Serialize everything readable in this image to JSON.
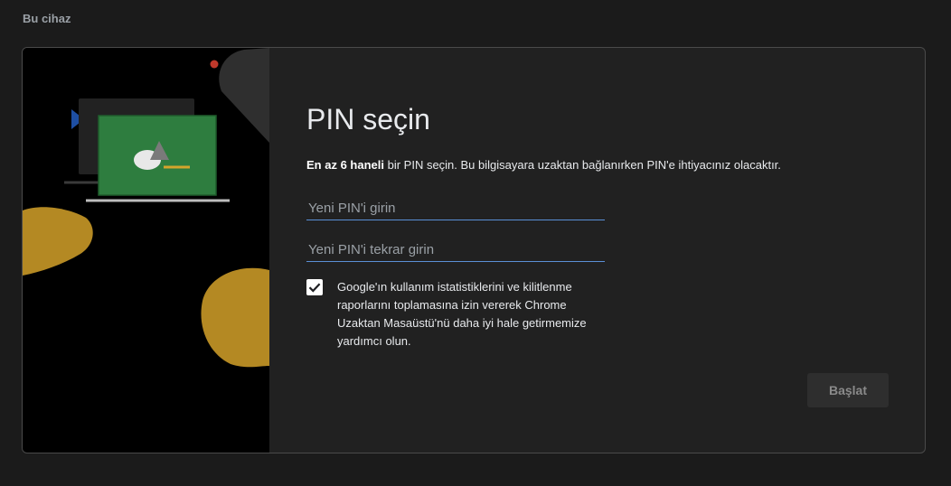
{
  "section": {
    "title": "Bu cihaz"
  },
  "dialog": {
    "title": "PIN seçin",
    "description_bold": "En az 6 haneli",
    "description_rest": " bir PIN seçin. Bu bilgisayara uzaktan bağlanırken PIN'e ihtiyacınız olacaktır.",
    "pin_placeholder": "Yeni PIN'i girin",
    "pin_confirm_placeholder": "Yeni PIN'i tekrar girin",
    "consent_checked": true,
    "consent_text": "Google'ın kullanım istatistiklerini ve kilitlenme raporlarını toplamasına izin vererek Chrome Uzaktan Masaüstü'nü daha iyi hale getirmemize yardımcı olun.",
    "start_label": "Başlat"
  },
  "colors": {
    "accent_blue": "#5a8fd6",
    "ochre": "#b48923",
    "screen_green": "#2e7d3f",
    "dot_red": "#c0392b",
    "play_blue": "#1e4fa3"
  }
}
